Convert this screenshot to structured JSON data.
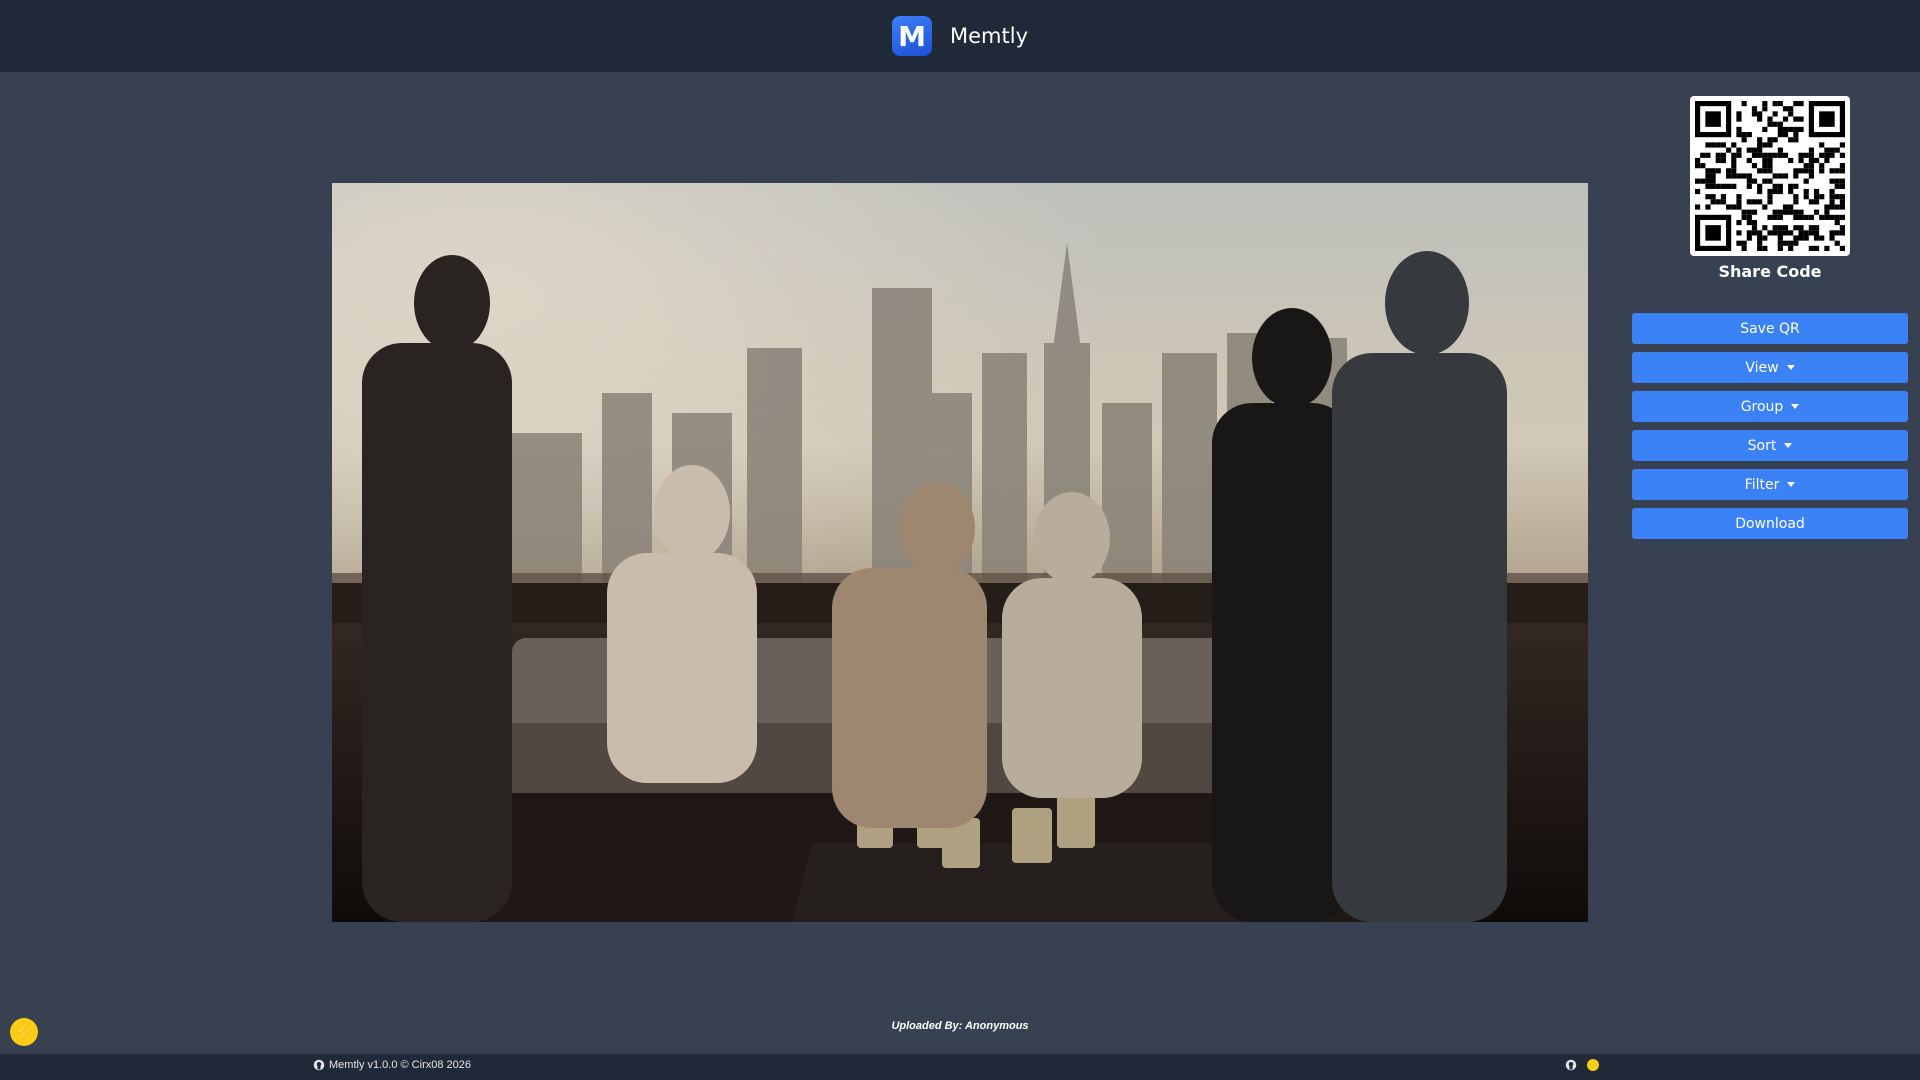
{
  "header": {
    "app_name": "Memtly",
    "logo_letter": "M"
  },
  "photo": {
    "alt": "Uploaded photo"
  },
  "share": {
    "label": "Share Code"
  },
  "actions": {
    "save_qr": "Save QR",
    "view": "View",
    "group": "Group",
    "sort": "Sort",
    "filter": "Filter",
    "download": "Download"
  },
  "upload_info": "Uploaded By: Anonymous",
  "footer": {
    "text": "Memtly v1.0.0 © Cirx08 2026"
  },
  "colors": {
    "header_bg": "#1f2937",
    "page_bg": "#374151",
    "button": "#3b82f6",
    "accent_yellow": "#facc15"
  },
  "icons": {
    "fab": "lightning-icon",
    "footer_left": "github-icon",
    "footer_right": [
      "github-icon",
      "coffee-icon"
    ]
  }
}
